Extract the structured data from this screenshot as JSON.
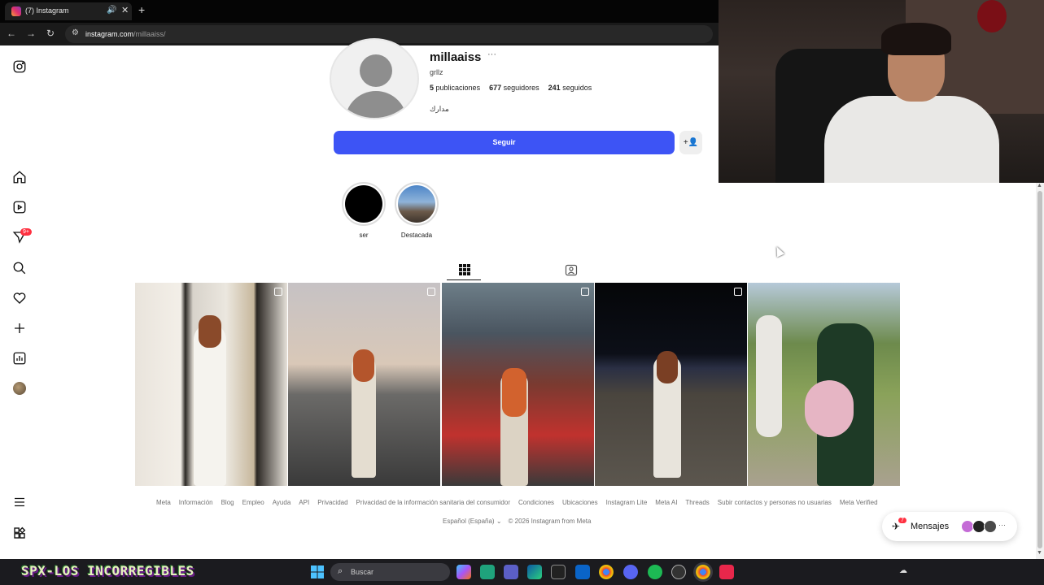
{
  "browser": {
    "tab_title": "(7) Instagram",
    "url_domain": "instagram.com",
    "url_path": "/millaaiss/"
  },
  "profile": {
    "username": "millaaiss",
    "more": "···",
    "full_name": "grllz",
    "posts_count": "5",
    "posts_label": "publicaciones",
    "followers_count": "677",
    "followers_label": "seguidores",
    "following_count": "241",
    "following_label": "seguidos",
    "bio": "مدارك",
    "follow_label": "Seguir",
    "suggest_icon": "+👤"
  },
  "highlights": [
    {
      "label": "ser",
      "color": "#000000"
    },
    {
      "label": "Destacada",
      "color": "#6f8fb5"
    }
  ],
  "leftnav_badge": "9+",
  "footer": {
    "links": [
      "Meta",
      "Información",
      "Blog",
      "Empleo",
      "Ayuda",
      "API",
      "Privacidad",
      "Privacidad de la información sanitaria del consumidor",
      "Condiciones",
      "Ubicaciones",
      "Instagram Lite",
      "Meta AI",
      "Threads",
      "Subir contactos y personas no usuarias",
      "Meta Verified"
    ],
    "language": "Español (España)",
    "copyright": "© 2026 Instagram from Meta"
  },
  "messages": {
    "label": "Mensajes",
    "badge": "7",
    "more": "···"
  },
  "taskbar": {
    "overlay_text": "SPX-LOS INCORREGIBLES",
    "search_placeholder": "Buscar"
  },
  "colors": {
    "follow_button": "#3d54f5",
    "badge": "#ff3040"
  }
}
